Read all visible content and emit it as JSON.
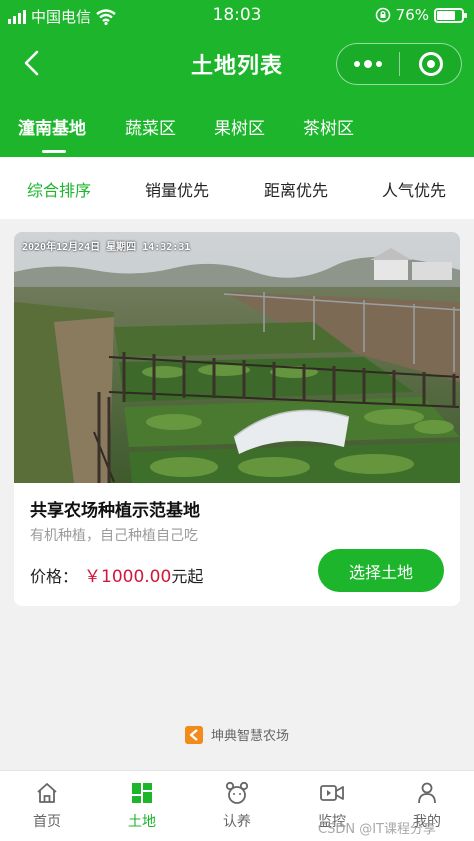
{
  "status_bar": {
    "carrier": "中国电信",
    "time": "18:03",
    "battery": "76%",
    "battery_level": 0.76
  },
  "navbar": {
    "title": "土地列表",
    "icons": [
      "back-icon",
      "more-icon",
      "close-icon"
    ]
  },
  "tabs": [
    {
      "label": "潼南基地",
      "active": true
    },
    {
      "label": "蔬菜区",
      "active": false
    },
    {
      "label": "果树区",
      "active": false
    },
    {
      "label": "茶树区",
      "active": false
    }
  ],
  "sort": [
    {
      "label": "综合排序",
      "active": true
    },
    {
      "label": "销量优先",
      "active": false
    },
    {
      "label": "距离优先",
      "active": false
    },
    {
      "label": "人气优先",
      "active": false
    }
  ],
  "card": {
    "photo_timestamp": "2020年12月24日  星期四  14:32:31",
    "title": "共享农场种植示范基地",
    "desc": "有机种植，自己种植自己吃",
    "price_label": "价格：",
    "price": "￥1000.00",
    "price_suffix": "元起",
    "button": "选择土地"
  },
  "brand": {
    "name": "坤典智慧农场"
  },
  "tabbar": [
    {
      "label": "首页",
      "icon": "home-icon",
      "active": false
    },
    {
      "label": "土地",
      "icon": "land-icon",
      "active": true
    },
    {
      "label": "认养",
      "icon": "adopt-icon",
      "active": false
    },
    {
      "label": "监控",
      "icon": "monitor-icon",
      "active": false
    },
    {
      "label": "我的",
      "icon": "user-icon",
      "active": false
    }
  ],
  "watermark": "CSDN @IT课程分享",
  "colors": {
    "primary": "#1cb52c",
    "price": "#d0183a",
    "background": "#f1f1f1"
  }
}
